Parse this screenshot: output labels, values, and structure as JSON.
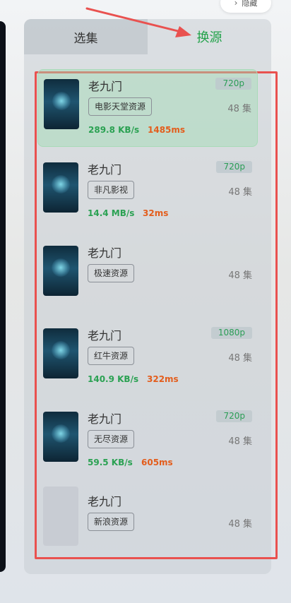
{
  "topbar": {
    "hide_label": "隐藏"
  },
  "tabs": [
    {
      "label": "选集",
      "active": false
    },
    {
      "label": "换源",
      "active": true
    }
  ],
  "colors": {
    "accent_green": "#22a24a",
    "ping_orange": "#e35d1c",
    "highlight_red": "#e9514f"
  },
  "sources": [
    {
      "title": "老九门",
      "quality": "720p",
      "source": "电影天堂资源",
      "episodes": "48 集",
      "speed": "289.8 KB/s",
      "ping": "1485ms",
      "selected": true,
      "poster": true
    },
    {
      "title": "老九门",
      "quality": "720p",
      "source": "非凡影视",
      "episodes": "48 集",
      "speed": "14.4 MB/s",
      "ping": "32ms",
      "selected": false,
      "poster": true
    },
    {
      "title": "老九门",
      "quality": "",
      "source": "极速资源",
      "episodes": "48 集",
      "speed": "",
      "ping": "",
      "selected": false,
      "poster": true
    },
    {
      "title": "老九门",
      "quality": "1080p",
      "source": "红牛资源",
      "episodes": "48 集",
      "speed": "140.9 KB/s",
      "ping": "322ms",
      "selected": false,
      "poster": true
    },
    {
      "title": "老九门",
      "quality": "720p",
      "source": "无尽资源",
      "episodes": "48 集",
      "speed": "59.5 KB/s",
      "ping": "605ms",
      "selected": false,
      "poster": true
    },
    {
      "title": "老九门",
      "quality": "",
      "source": "新浪资源",
      "episodes": "48 集",
      "speed": "",
      "ping": "",
      "selected": false,
      "poster": false
    }
  ]
}
